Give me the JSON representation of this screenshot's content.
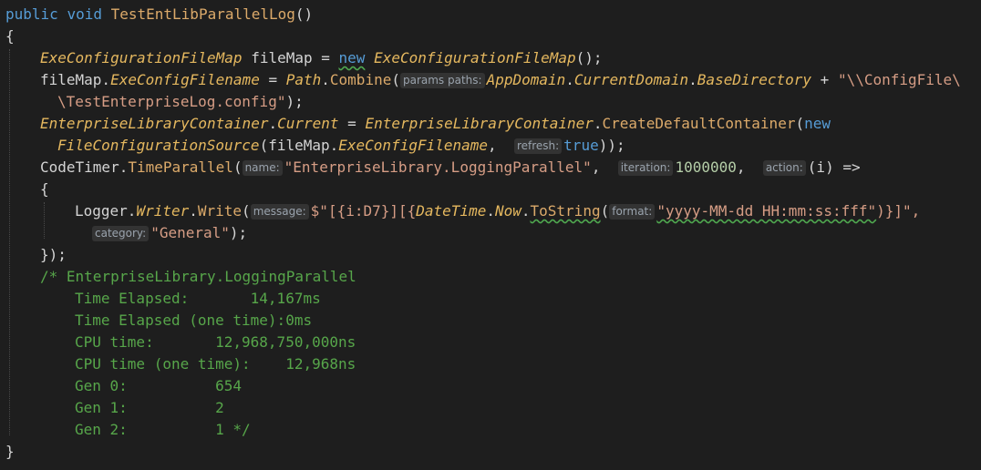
{
  "editor": {
    "lines": [
      {
        "indent": 0,
        "tokens": [
          {
            "t": "public",
            "c": "kw"
          },
          {
            "t": " ",
            "c": "pl"
          },
          {
            "t": "void",
            "c": "kw"
          },
          {
            "t": " ",
            "c": "pl"
          },
          {
            "t": "TestEntLibParallelLog",
            "c": "fn"
          },
          {
            "t": "()",
            "c": "pl"
          }
        ]
      },
      {
        "indent": 0,
        "tokens": [
          {
            "t": "{",
            "c": "pl"
          }
        ]
      },
      {
        "indent": 1,
        "tokens": [
          {
            "t": "ExeConfigurationFileMap",
            "c": "it"
          },
          {
            "t": " fileMap = ",
            "c": "pl"
          },
          {
            "t": "new",
            "c": "kw squiggle"
          },
          {
            "t": " ",
            "c": "pl"
          },
          {
            "t": "ExeConfigurationFileMap",
            "c": "it"
          },
          {
            "t": "();",
            "c": "pl"
          }
        ]
      },
      {
        "indent": 1,
        "tokens": [
          {
            "t": "fileMap.",
            "c": "pl"
          },
          {
            "t": "ExeConfigFilename",
            "c": "it"
          },
          {
            "t": " = ",
            "c": "pl"
          },
          {
            "t": "Path",
            "c": "it"
          },
          {
            "t": ".",
            "c": "pl"
          },
          {
            "t": "Combine",
            "c": "fn"
          },
          {
            "t": "(",
            "c": "pl"
          },
          {
            "h": "params paths:"
          },
          {
            "t": "AppDomain",
            "c": "it"
          },
          {
            "t": ".",
            "c": "pl"
          },
          {
            "t": "CurrentDomain",
            "c": "it"
          },
          {
            "t": ".",
            "c": "pl"
          },
          {
            "t": "BaseDirectory",
            "c": "it"
          },
          {
            "t": " + ",
            "c": "pl"
          },
          {
            "t": "\"\\\\ConfigFile\\",
            "c": "st"
          }
        ]
      },
      {
        "indent": 1.5,
        "tokens": [
          {
            "t": "\\TestEnterpriseLog.config\"",
            "c": "st"
          },
          {
            "t": ");",
            "c": "pl"
          }
        ]
      },
      {
        "indent": 1,
        "tokens": [
          {
            "t": "EnterpriseLibraryContainer",
            "c": "it"
          },
          {
            "t": ".",
            "c": "pl"
          },
          {
            "t": "Current",
            "c": "it"
          },
          {
            "t": " = ",
            "c": "pl"
          },
          {
            "t": "EnterpriseLibraryContainer",
            "c": "it"
          },
          {
            "t": ".",
            "c": "pl"
          },
          {
            "t": "CreateDefaultContainer",
            "c": "fn"
          },
          {
            "t": "(",
            "c": "pl"
          },
          {
            "t": "new",
            "c": "kw"
          }
        ]
      },
      {
        "indent": 1.5,
        "tokens": [
          {
            "t": "FileConfigurationSource",
            "c": "it"
          },
          {
            "t": "(fileMap.",
            "c": "pl"
          },
          {
            "t": "ExeConfigFilename",
            "c": "it"
          },
          {
            "t": ",  ",
            "c": "pl"
          },
          {
            "h": "refresh:"
          },
          {
            "t": "true",
            "c": "kw"
          },
          {
            "t": "));",
            "c": "pl"
          }
        ]
      },
      {
        "indent": 1,
        "tokens": [
          {
            "t": "CodeTimer",
            "c": "pl"
          },
          {
            "t": ".",
            "c": "pl"
          },
          {
            "t": "TimeParallel",
            "c": "fn"
          },
          {
            "t": "(",
            "c": "pl"
          },
          {
            "h": "name:"
          },
          {
            "t": "\"EnterpriseLibrary.LoggingParallel\"",
            "c": "st"
          },
          {
            "t": ",  ",
            "c": "pl"
          },
          {
            "h": "iteration:"
          },
          {
            "t": "1000000",
            "c": "num"
          },
          {
            "t": ",  ",
            "c": "pl"
          },
          {
            "h": "action:"
          },
          {
            "t": "(i) =>",
            "c": "pl"
          }
        ]
      },
      {
        "indent": 1,
        "tokens": [
          {
            "t": "{",
            "c": "pl"
          }
        ]
      },
      {
        "indent": 2,
        "tokens": [
          {
            "t": "Logger",
            "c": "pl"
          },
          {
            "t": ".",
            "c": "pl"
          },
          {
            "t": "Writer",
            "c": "it"
          },
          {
            "t": ".",
            "c": "pl"
          },
          {
            "t": "Write",
            "c": "fn"
          },
          {
            "t": "(",
            "c": "pl"
          },
          {
            "h": "message:"
          },
          {
            "t": "$\"[{i:D7}][{",
            "c": "st"
          },
          {
            "t": "DateTime",
            "c": "it"
          },
          {
            "t": ".",
            "c": "pl"
          },
          {
            "t": "Now",
            "c": "it"
          },
          {
            "t": ".",
            "c": "pl"
          },
          {
            "t": "ToString",
            "c": "fn squiggle"
          },
          {
            "t": "(",
            "c": "pl"
          },
          {
            "h": "format:"
          },
          {
            "t": "\"yyyy-MM-dd HH:mm:ss:fff\"",
            "c": "st squiggle"
          },
          {
            "t": ")}]\",",
            "c": "st"
          }
        ]
      },
      {
        "indent": 2.5,
        "tokens": [
          {
            "h": "category:"
          },
          {
            "t": "\"General\"",
            "c": "st"
          },
          {
            "t": ");",
            "c": "pl"
          }
        ]
      },
      {
        "indent": 1,
        "tokens": [
          {
            "t": "});",
            "c": "pl"
          }
        ]
      },
      {
        "indent": 1,
        "tokens": [
          {
            "t": "/* EnterpriseLibrary.LoggingParallel",
            "c": "cm"
          }
        ]
      },
      {
        "indent": 2,
        "tokens": [
          {
            "t": "Time Elapsed:       14,167ms",
            "c": "cm"
          }
        ]
      },
      {
        "indent": 2,
        "tokens": [
          {
            "t": "Time Elapsed (one time):0ms",
            "c": "cm"
          }
        ]
      },
      {
        "indent": 2,
        "tokens": [
          {
            "t": "CPU time:       12,968,750,000ns",
            "c": "cm"
          }
        ]
      },
      {
        "indent": 2,
        "tokens": [
          {
            "t": "CPU time (one time):    12,968ns",
            "c": "cm"
          }
        ]
      },
      {
        "indent": 2,
        "tokens": [
          {
            "t": "Gen 0:          654",
            "c": "cm"
          }
        ]
      },
      {
        "indent": 2,
        "tokens": [
          {
            "t": "Gen 1:          2",
            "c": "cm"
          }
        ]
      },
      {
        "indent": 2,
        "tokens": [
          {
            "t": "Gen 2:          1 */",
            "c": "cm"
          }
        ]
      },
      {
        "indent": 0,
        "tokens": [
          {
            "t": "}",
            "c": "pl"
          }
        ]
      }
    ]
  }
}
